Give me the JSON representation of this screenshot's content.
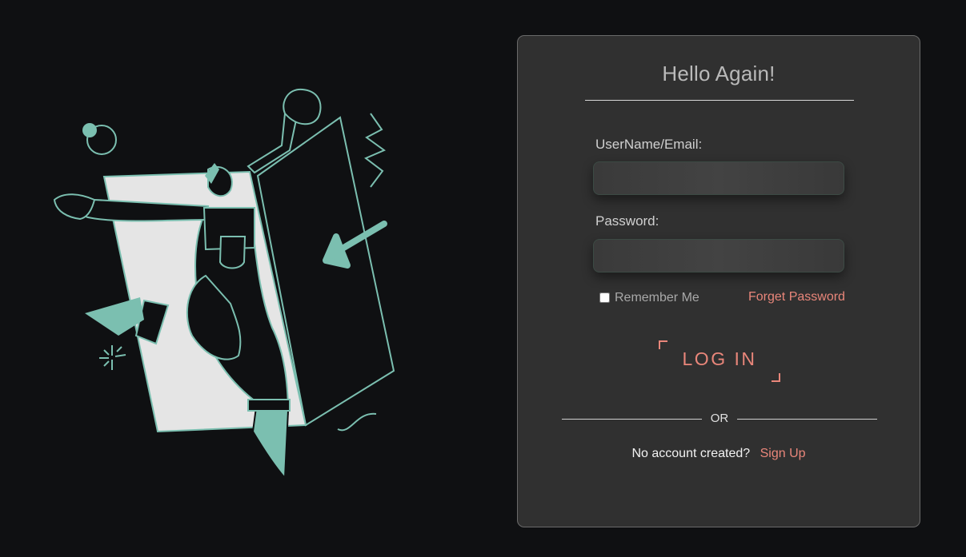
{
  "login": {
    "title": "Hello Again!",
    "username_label": "UserName/Email:",
    "username_value": "",
    "password_label": "Password:",
    "password_value": "",
    "remember_label": "Remember Me",
    "remember_checked": false,
    "forgot_label": "Forget Password",
    "submit_label": "LOG IN",
    "divider_text": "OR",
    "no_account_text": "No account created?",
    "signup_label": "Sign Up"
  },
  "colors": {
    "background": "#0f1012",
    "card": "#303030",
    "accent": "#e9867a",
    "illustration_teal": "#7bbfb0",
    "illustration_panel": "#e5e5e5"
  }
}
